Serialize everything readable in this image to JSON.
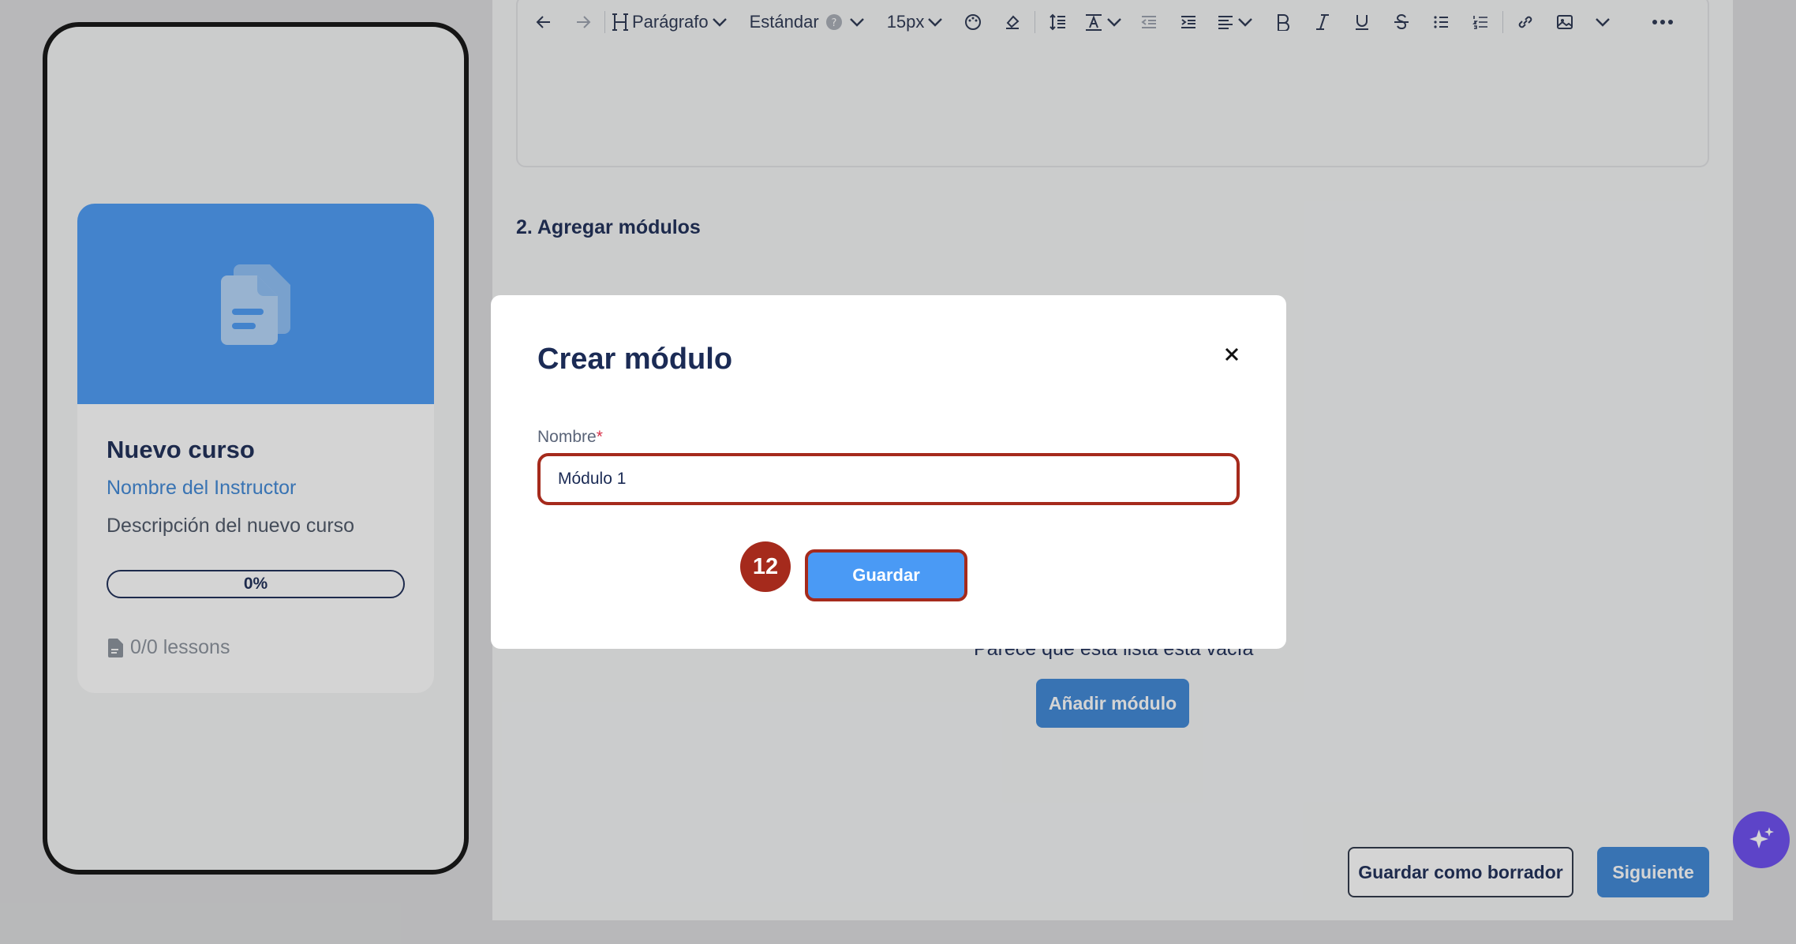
{
  "editor": {
    "toolbar": {
      "heading_style": "Parágrafo",
      "font_family": "Estándar",
      "font_size": "15px",
      "icons": [
        "undo-icon",
        "redo-icon",
        "heading-icon",
        "help-icon",
        "palette-icon",
        "highlight-icon",
        "line-height-icon",
        "text-format-icon",
        "outdent-icon",
        "indent-icon",
        "align-icon",
        "bold-icon",
        "italic-icon",
        "underline-icon",
        "strikethrough-icon",
        "bullet-list-icon",
        "numbered-list-icon",
        "link-icon",
        "image-icon",
        "chevron-down-icon",
        "more-icon"
      ]
    }
  },
  "section": {
    "title": "2. Agregar módulos",
    "empty_message": "Parece que esta lista está vacía",
    "add_module_label": "Añadir módulo"
  },
  "footer": {
    "draft_label": "Guardar como borrador",
    "next_label": "Siguiente"
  },
  "preview_card": {
    "title": "Nuevo curso",
    "instructor": "Nombre del Instructor",
    "description": "Descripción del nuevo curso",
    "progress": "0%",
    "lessons": "0/0 lessons"
  },
  "modal": {
    "title": "Crear módulo",
    "field_label": "Nombre",
    "required_mark": "*",
    "field_value": "Módulo 1",
    "save_label": "Guardar",
    "step_badge": "12"
  },
  "colors": {
    "accent": "#4a9af5",
    "primary_button": "#3d86d6",
    "highlight": "#a52a1c",
    "text_dark": "#1b2b55"
  }
}
